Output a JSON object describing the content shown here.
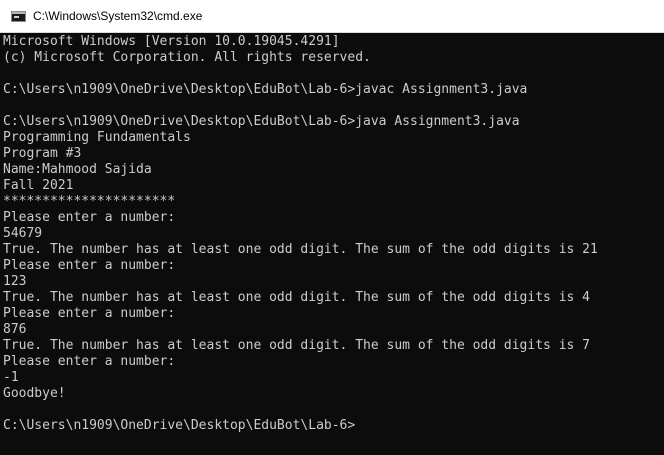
{
  "window": {
    "title": "C:\\Windows\\System32\\cmd.exe",
    "icon": "console-window-icon"
  },
  "console": {
    "lines": [
      "Microsoft Windows [Version 10.0.19045.4291]",
      "(c) Microsoft Corporation. All rights reserved.",
      "",
      "C:\\Users\\n1909\\OneDrive\\Desktop\\EduBot\\Lab-6>javac Assignment3.java",
      "",
      "C:\\Users\\n1909\\OneDrive\\Desktop\\EduBot\\Lab-6>java Assignment3.java",
      "Programming Fundamentals",
      "Program #3",
      "Name:Mahmood Sajida",
      "Fall 2021",
      "**********************",
      "Please enter a number:",
      "54679",
      "True. The number has at least one odd digit. The sum of the odd digits is 21",
      "Please enter a number:",
      "123",
      "True. The number has at least one odd digit. The sum of the odd digits is 4",
      "Please enter a number:",
      "876",
      "True. The number has at least one odd digit. The sum of the odd digits is 7",
      "Please enter a number:",
      "-1",
      "Goodbye!",
      "",
      "C:\\Users\\n1909\\OneDrive\\Desktop\\EduBot\\Lab-6>"
    ]
  }
}
